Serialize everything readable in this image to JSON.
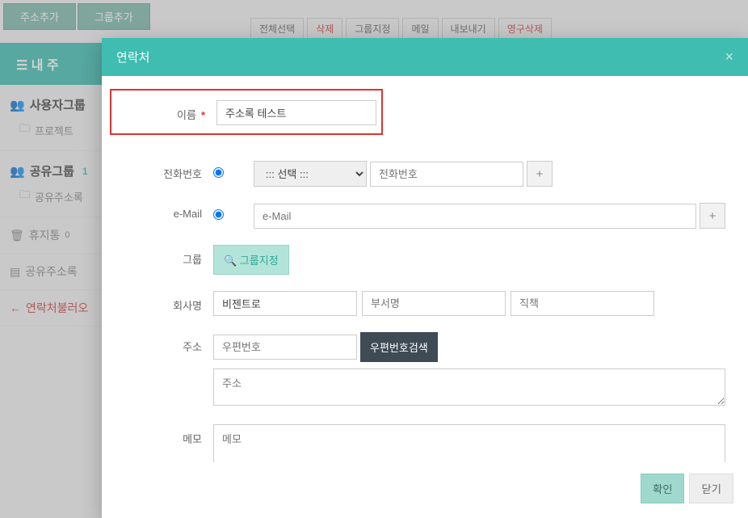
{
  "bg": {
    "add_address": "주소추가",
    "add_group": "그룹추가",
    "sidebar_header": "☰ 내 주",
    "user_group": "사용자그룹",
    "project": "프로젝트",
    "shared_group": "공유그룹",
    "shared_count": "1",
    "shared_address": "공유주소록",
    "trash": "휴지통",
    "trash_count": "0",
    "shared_address_book": "공유주소록",
    "import_contacts": "연락처불러오",
    "toolbar": {
      "select_all": "전체선택",
      "delete": "삭제",
      "assign_group": "그룹지정",
      "mail": "메일",
      "export": "내보내기",
      "perm_delete": "영구삭제"
    }
  },
  "modal": {
    "title": "연락처",
    "labels": {
      "name": "이름",
      "phone": "전화번호",
      "email": "e-Mail",
      "group": "그룹",
      "company": "회사명",
      "address": "주소",
      "memo": "메모"
    },
    "values": {
      "name": "주소록 테스트",
      "company": "비젠트로"
    },
    "placeholders": {
      "phone": "전화번호",
      "email": "e-Mail",
      "department": "부서명",
      "position": "직책",
      "postal": "우편번호",
      "address": "주소",
      "memo": "메모"
    },
    "phone_select": "::: 선택 :::",
    "buttons": {
      "group_assign": "그룹지정",
      "postal_search": "우편번호검색",
      "confirm": "확인",
      "close": "닫기"
    }
  }
}
